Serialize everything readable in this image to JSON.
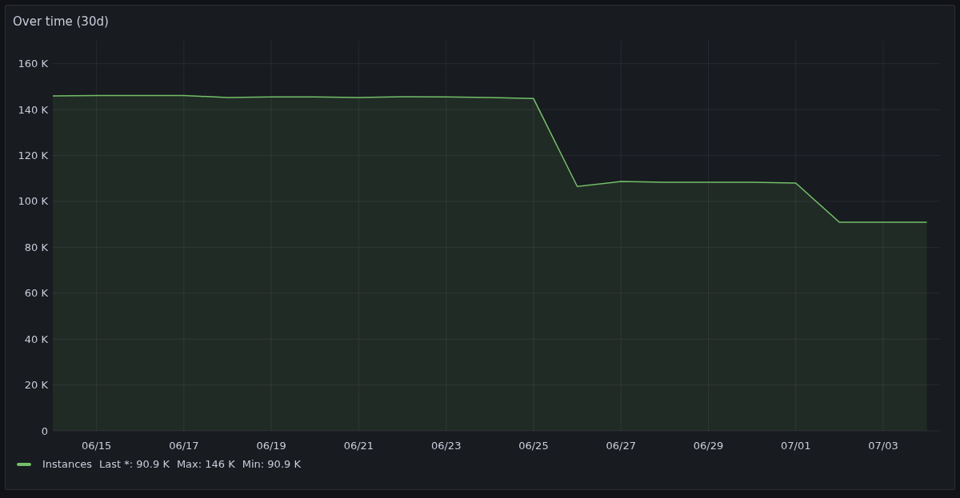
{
  "panel": {
    "title": "Over time (30d)",
    "chart_data": {
      "type": "area",
      "grid": true,
      "categories": [
        null,
        "06/15",
        null,
        "06/17",
        null,
        "06/19",
        null,
        "06/21",
        null,
        "06/23",
        null,
        "06/25",
        null,
        "06/27",
        null,
        "06/29",
        null,
        "07/01",
        null,
        "07/03",
        null
      ],
      "series": [
        {
          "name": "Instances",
          "color": "#73bf69",
          "values": [
            146000,
            146100,
            146100,
            146100,
            145300,
            145500,
            145500,
            145300,
            145600,
            145500,
            145300,
            144800,
            106500,
            108700,
            108300,
            108300,
            108300,
            108000,
            90900,
            90900,
            90900
          ]
        }
      ],
      "ylim": [
        0,
        170000
      ],
      "yticks": [
        {
          "value": 0,
          "label": "0"
        },
        {
          "value": 20000,
          "label": "20 K"
        },
        {
          "value": 40000,
          "label": "40 K"
        },
        {
          "value": 60000,
          "label": "60 K"
        },
        {
          "value": 80000,
          "label": "80 K"
        },
        {
          "value": 100000,
          "label": "100 K"
        },
        {
          "value": 120000,
          "label": "120 K"
        },
        {
          "value": 140000,
          "label": "140 K"
        },
        {
          "value": 160000,
          "label": "160 K"
        }
      ]
    },
    "legend": [
      {
        "stats": [
          "Last *: 90.9 K",
          "Max: 146 K",
          "Min: 90.9 K"
        ]
      }
    ]
  }
}
